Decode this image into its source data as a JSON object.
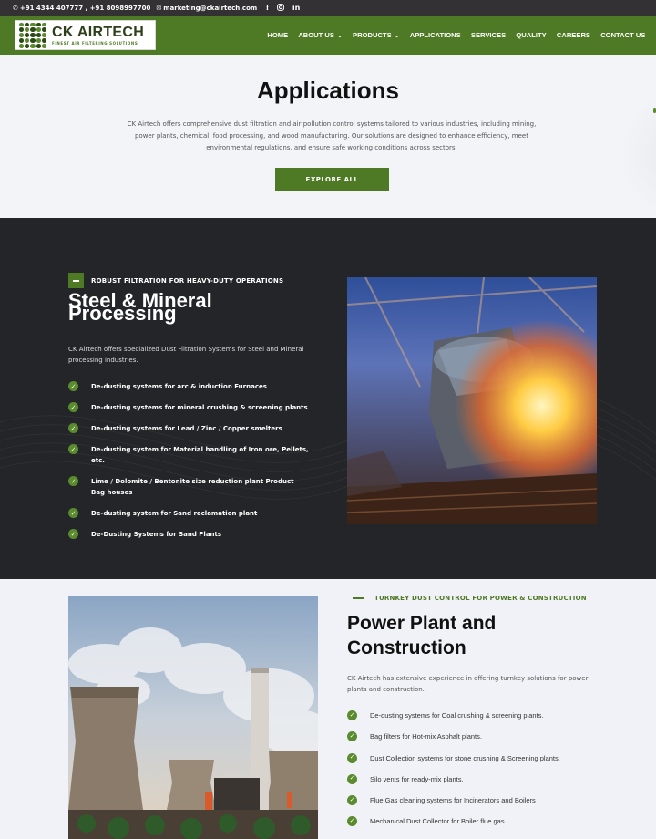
{
  "topbar": {
    "phone": "+91 4344 407777 , +91 8098997700",
    "email": "marketing@ckairtech.com",
    "phone_icon": "phone-icon",
    "email_icon": "mail-icon",
    "social_icons": [
      "facebook-icon",
      "instagram-icon",
      "linkedin-icon"
    ]
  },
  "brand": {
    "name": "CK AIRTECH",
    "tagline": "FINEST AIR FILTERING SOLUTIONS",
    "color": "#4f7a25"
  },
  "nav": {
    "items": [
      {
        "label": "HOME",
        "dropdown": false
      },
      {
        "label": "ABOUT US",
        "dropdown": true
      },
      {
        "label": "PRODUCTS",
        "dropdown": true
      },
      {
        "label": "APPLICATIONS",
        "dropdown": false
      },
      {
        "label": "SERVICES",
        "dropdown": false
      },
      {
        "label": "QUALITY",
        "dropdown": false
      },
      {
        "label": "CAREERS",
        "dropdown": false
      },
      {
        "label": "CONTACT US",
        "dropdown": false
      }
    ]
  },
  "hero": {
    "title": "Applications",
    "description": "CK Airtech offers comprehensive dust filtration and air pollution control systems tailored to various industries, including mining, power plants, chemical, food processing, and wood manufacturing. Our solutions are designed to enhance efficiency, meet environmental regulations, and ensure safe working conditions across sectors.",
    "button": "EXPLORE ALL"
  },
  "steel": {
    "tag": "ROBUST FILTRATION FOR HEAVY-DUTY OPERATIONS",
    "title": "Steel & Mineral Processing",
    "description": "CK Airtech offers specialized Dust Filtration Systems for Steel and Mineral processing industries.",
    "items": [
      "De-dusting systems for arc & induction Furnaces",
      "De-dusting systems for mineral crushing & screening plants",
      "De-dusting systems for Lead / Zinc / Copper smelters",
      "De-dusting system for Material handling of Iron ore, Pellets, etc.",
      "Lime / Dolomite / Bentonite size reduction plant Product Bag houses",
      "De-dusting system for Sand reclamation plant",
      "De-Dusting Systems for Sand Plants"
    ]
  },
  "power": {
    "tag": "TURNKEY DUST CONTROL FOR POWER & CONSTRUCTION",
    "title": "Power Plant and Construction",
    "description": "CK Airtech has extensive experience in offering turnkey solutions for power plants and construction.",
    "items": [
      "De-dusting systems for Coal crushing & screening plants.",
      "Bag filters for Hot-mix Asphalt plants.",
      "Dust Collection systems for stone crushing & Screening plants.",
      "Silo vents for ready-mix plants.",
      "Flue Gas cleaning systems for Incinerators and Boilers",
      "Mechanical Dust Collector for Boiler flue gas"
    ]
  }
}
